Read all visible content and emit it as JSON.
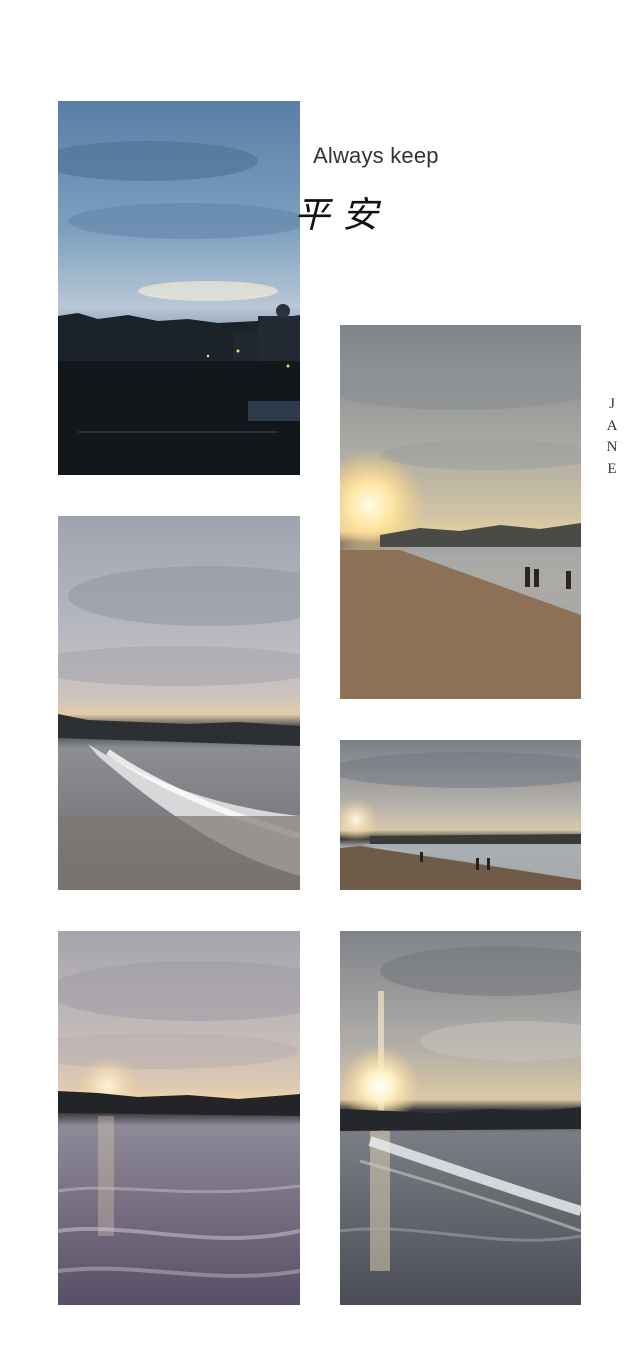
{
  "caption": {
    "english": "Always keep",
    "chinese": "平安"
  },
  "signature": {
    "letters": [
      "J",
      "A",
      "N",
      "E"
    ]
  },
  "photos": [
    {
      "subject": "dusk cityscape under blue sky"
    },
    {
      "subject": "sunset over beach with walking people"
    },
    {
      "subject": "waves rolling onto shore at dusk"
    },
    {
      "subject": "wide sunset beach with silhouettes"
    },
    {
      "subject": "sun setting behind treeline over sea"
    },
    {
      "subject": "sun glare reflecting on waves"
    }
  ]
}
